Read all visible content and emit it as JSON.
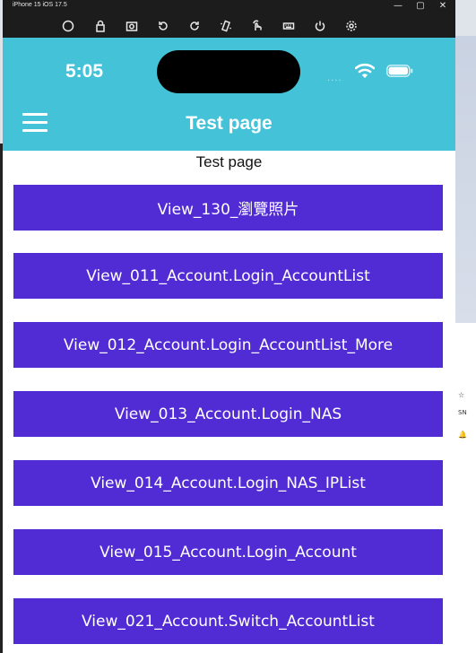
{
  "window": {
    "title": "iPhone 15 iOS 17.5",
    "minimize_glyph": "—",
    "maximize_glyph": "▢",
    "close_glyph": "✕"
  },
  "toolbar": {
    "icons": [
      "home-icon",
      "lock-icon",
      "screenshot-icon",
      "rotate-left-icon",
      "rotate-right-icon",
      "shake-icon",
      "touch-icon",
      "keyboard-icon",
      "power-icon",
      "settings-icon"
    ]
  },
  "status_bar": {
    "time": "5:05",
    "signal": "....",
    "wifi_icon": "wifi-icon",
    "battery_icon": "battery-icon"
  },
  "app_header": {
    "title": "Test page",
    "menu_icon": "hamburger-menu-icon",
    "color": "#44c2d8"
  },
  "content": {
    "label": "Test page",
    "button_color": "#512bd4",
    "buttons": [
      "View_130_瀏覽照片",
      "View_011_Account.Login_AccountList",
      "View_012_Account.Login_AccountList_More",
      "View_013_Account.Login_NAS",
      "View_014_Account.Login_NAS_IPList",
      "View_015_Account.Login_Account",
      "View_021_Account.Switch_AccountList"
    ]
  },
  "background_app": {
    "glyphs": [
      "☆",
      "SN",
      "🔔"
    ]
  }
}
